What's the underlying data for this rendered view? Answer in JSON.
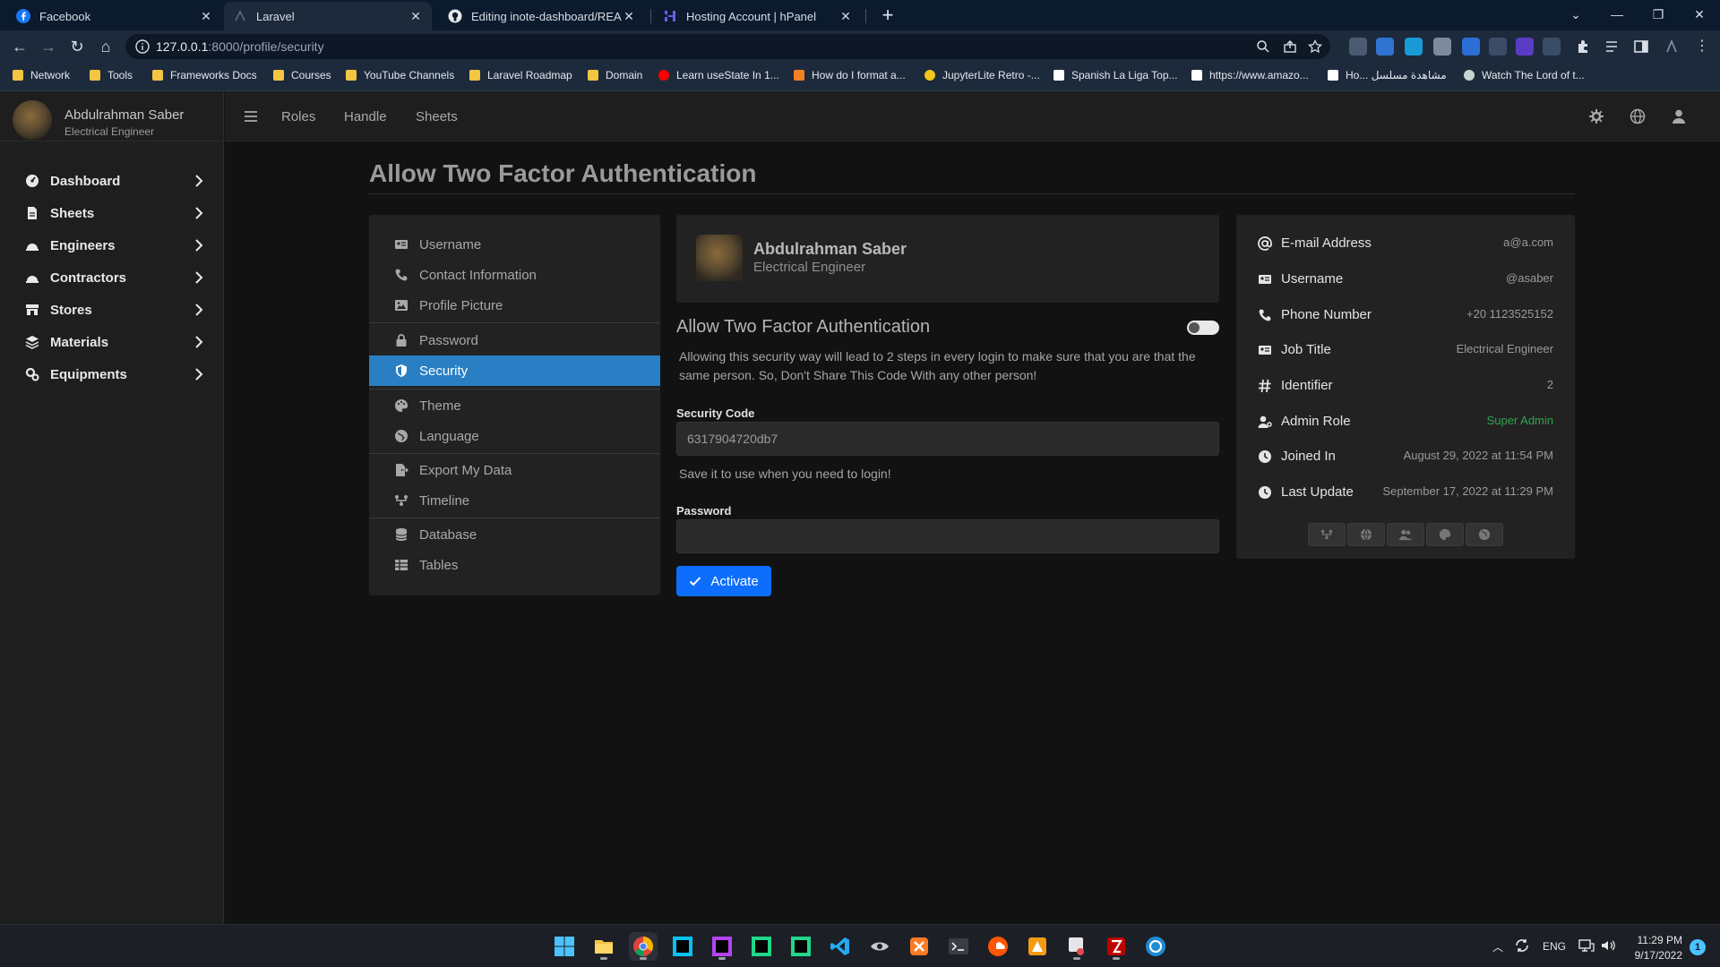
{
  "browser": {
    "tabs": [
      {
        "title": "Facebook",
        "icon": "facebook-icon"
      },
      {
        "title": "Laravel",
        "icon": "laravel-icon"
      },
      {
        "title": "Editing inote-dashboard/READM",
        "icon": "github-icon"
      },
      {
        "title": "Hosting Account | hPanel",
        "icon": "hostinger-icon"
      }
    ],
    "active_tab_index": 1,
    "url_host": "127.0.0.1",
    "url_rest": ":8000/profile/security",
    "bookmarks": [
      {
        "label": "Network",
        "icon": "folder-icon"
      },
      {
        "label": "Tools",
        "icon": "folder-icon"
      },
      {
        "label": "Frameworks Docs",
        "icon": "folder-icon"
      },
      {
        "label": "Courses",
        "icon": "folder-icon"
      },
      {
        "label": "YouTube Channels",
        "icon": "folder-icon"
      },
      {
        "label": "Laravel Roadmap",
        "icon": "folder-icon"
      },
      {
        "label": "Domain",
        "icon": "folder-icon"
      },
      {
        "label": "Learn useState In 1...",
        "icon": "youtube-icon"
      },
      {
        "label": "How do I format a...",
        "icon": "stackoverflow-icon"
      },
      {
        "label": "JupyterLite Retro -...",
        "icon": "jupyter-icon"
      },
      {
        "label": "Spanish La Liga Top...",
        "icon": "site-icon"
      },
      {
        "label": "https://www.amazo...",
        "icon": "amazon-icon"
      },
      {
        "label": "Ho... مشاهدة مسلسل",
        "icon": "site-icon"
      },
      {
        "label": "Watch The Lord of t...",
        "icon": "site-icon"
      }
    ]
  },
  "app": {
    "user": {
      "name": "Abdulrahman Saber",
      "role": "Electrical Engineer"
    },
    "sidebar": [
      {
        "label": "Dashboard",
        "icon": "dashboard-icon"
      },
      {
        "label": "Sheets",
        "icon": "file-icon"
      },
      {
        "label": "Engineers",
        "icon": "hardhat-icon"
      },
      {
        "label": "Contractors",
        "icon": "hardhat-icon"
      },
      {
        "label": "Stores",
        "icon": "store-icon"
      },
      {
        "label": "Materials",
        "icon": "layers-icon"
      },
      {
        "label": "Equipments",
        "icon": "gears-icon"
      }
    ],
    "topnav": {
      "links": [
        "Roles",
        "Handle",
        "Sheets"
      ]
    },
    "page_title": "Allow Two Factor Authentication",
    "profile_menu": {
      "groups": [
        [
          {
            "label": "Username",
            "icon": "id-card-icon"
          },
          {
            "label": "Contact Information",
            "icon": "phone-icon"
          },
          {
            "label": "Profile Picture",
            "icon": "image-icon"
          }
        ],
        [
          {
            "label": "Password",
            "icon": "lock-icon"
          },
          {
            "label": "Security",
            "icon": "shield-icon",
            "active": true
          }
        ],
        [
          {
            "label": "Theme",
            "icon": "palette-icon"
          },
          {
            "label": "Language",
            "icon": "globe-icon"
          }
        ],
        [
          {
            "label": "Export My Data",
            "icon": "file-export-icon"
          },
          {
            "label": "Timeline",
            "icon": "timeline-icon"
          }
        ],
        [
          {
            "label": "Database",
            "icon": "database-icon"
          },
          {
            "label": "Tables",
            "icon": "table-icon"
          }
        ]
      ]
    },
    "security": {
      "heading": "Allow Two Factor Authentication",
      "description": "Allowing this security way will lead to 2 steps in every login to make sure that you are that the same person. So, Don't Share This Code With any other person!",
      "code_label": "Security Code",
      "code_value": "6317904720db7",
      "code_hint": "Save it to use when you need to login!",
      "password_label": "Password",
      "password_value": "",
      "activate_label": "Activate",
      "toggle_on": false
    },
    "info": [
      {
        "label": "E-mail Address",
        "value": "a@a.com",
        "icon": "at-icon"
      },
      {
        "label": "Username",
        "value": "@asaber",
        "icon": "id-card-icon"
      },
      {
        "label": "Phone Number",
        "value": "+20 1123525152",
        "icon": "phone-icon"
      },
      {
        "label": "Job Title",
        "value": "Electrical Engineer",
        "icon": "id-card-icon"
      },
      {
        "label": "Identifier",
        "value": "2",
        "icon": "hash-icon"
      },
      {
        "label": "Admin Role",
        "value": "Super Admin",
        "icon": "user-cog-icon",
        "color": "#2ea44f"
      },
      {
        "label": "Joined In",
        "value": "August 29, 2022 at 11:54 PM",
        "icon": "clock-icon"
      },
      {
        "label": "Last Update",
        "value": "September 17, 2022 at 11:29 PM",
        "icon": "clock-icon"
      }
    ]
  },
  "taskbar": {
    "lang": "ENG",
    "time": "11:29 PM",
    "date": "9/17/2022",
    "notifications": "1"
  },
  "colors": {
    "accent": "#0d6efd",
    "menu_active": "#2a7fc4",
    "success": "#2ea44f"
  }
}
